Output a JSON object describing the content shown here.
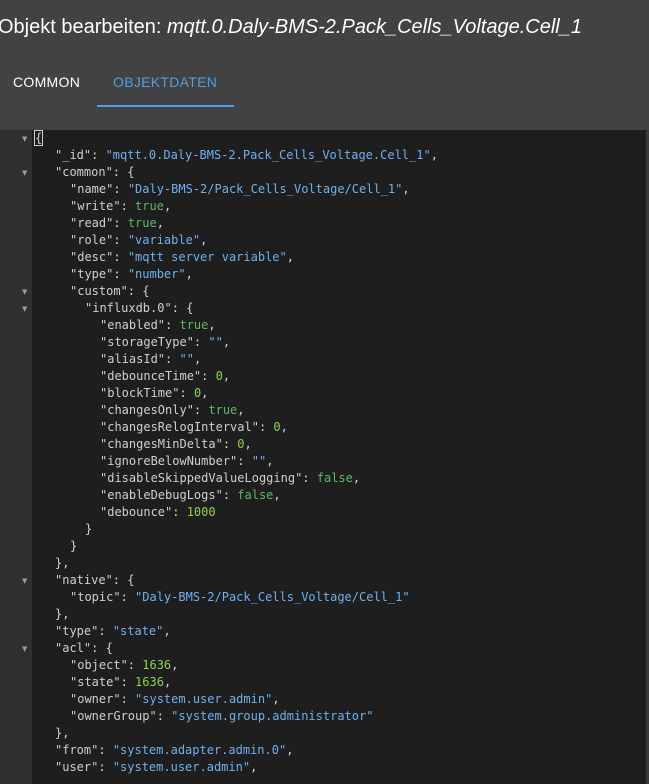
{
  "dialog": {
    "title_prefix": "Objekt bearbeiten:",
    "title_object": "mqtt.0.Daly-BMS-2.Pack_Cells_Voltage.Cell_1"
  },
  "tabs": [
    {
      "label": "COMMON",
      "active": false
    },
    {
      "label": "OBJEKTDATEN",
      "active": true
    }
  ],
  "colors": {
    "accent": "#4f9ee3",
    "string": "#6fb0ee",
    "number": "#8fd14f",
    "boolean": "#5fb86a",
    "editor_bg": "#1e1e1e",
    "header_bg": "#424242"
  },
  "fold_icon": "caret-down-icon",
  "editor": {
    "lines": [
      {
        "indent": 0,
        "fold": true,
        "parts": [
          [
            "{",
            "cb"
          ]
        ]
      },
      {
        "indent": 1,
        "fold": false,
        "parts": [
          [
            "\"_id\"",
            "k"
          ],
          [
            ": ",
            "p"
          ],
          [
            "\"mqtt.0.Daly-BMS-2.Pack_Cells_Voltage.Cell_1\"",
            "s"
          ],
          [
            ",",
            "p"
          ]
        ]
      },
      {
        "indent": 1,
        "fold": true,
        "parts": [
          [
            "\"common\"",
            "k"
          ],
          [
            ": {",
            "p"
          ]
        ]
      },
      {
        "indent": 2,
        "fold": false,
        "parts": [
          [
            "\"name\"",
            "k"
          ],
          [
            ": ",
            "p"
          ],
          [
            "\"Daly-BMS-2/Pack_Cells_Voltage/Cell_1\"",
            "s"
          ],
          [
            ",",
            "p"
          ]
        ]
      },
      {
        "indent": 2,
        "fold": false,
        "parts": [
          [
            "\"write\"",
            "k"
          ],
          [
            ": ",
            "p"
          ],
          [
            "true",
            "b"
          ],
          [
            ",",
            "p"
          ]
        ]
      },
      {
        "indent": 2,
        "fold": false,
        "parts": [
          [
            "\"read\"",
            "k"
          ],
          [
            ": ",
            "p"
          ],
          [
            "true",
            "b"
          ],
          [
            ",",
            "p"
          ]
        ]
      },
      {
        "indent": 2,
        "fold": false,
        "parts": [
          [
            "\"role\"",
            "k"
          ],
          [
            ": ",
            "p"
          ],
          [
            "\"variable\"",
            "s"
          ],
          [
            ",",
            "p"
          ]
        ]
      },
      {
        "indent": 2,
        "fold": false,
        "parts": [
          [
            "\"desc\"",
            "k"
          ],
          [
            ": ",
            "p"
          ],
          [
            "\"mqtt server variable\"",
            "s"
          ],
          [
            ",",
            "p"
          ]
        ]
      },
      {
        "indent": 2,
        "fold": false,
        "parts": [
          [
            "\"type\"",
            "k"
          ],
          [
            ": ",
            "p"
          ],
          [
            "\"number\"",
            "s"
          ],
          [
            ",",
            "p"
          ]
        ]
      },
      {
        "indent": 2,
        "fold": true,
        "parts": [
          [
            "\"custom\"",
            "k"
          ],
          [
            ": {",
            "p"
          ]
        ]
      },
      {
        "indent": 3,
        "fold": true,
        "parts": [
          [
            "\"influxdb.0\"",
            "k"
          ],
          [
            ": {",
            "p"
          ]
        ]
      },
      {
        "indent": 4,
        "fold": false,
        "parts": [
          [
            "\"enabled\"",
            "k"
          ],
          [
            ": ",
            "p"
          ],
          [
            "true",
            "b"
          ],
          [
            ",",
            "p"
          ]
        ]
      },
      {
        "indent": 4,
        "fold": false,
        "parts": [
          [
            "\"storageType\"",
            "k"
          ],
          [
            ": ",
            "p"
          ],
          [
            "\"\"",
            "s"
          ],
          [
            ",",
            "p"
          ]
        ]
      },
      {
        "indent": 4,
        "fold": false,
        "parts": [
          [
            "\"aliasId\"",
            "k"
          ],
          [
            ": ",
            "p"
          ],
          [
            "\"\"",
            "s"
          ],
          [
            ",",
            "p"
          ]
        ]
      },
      {
        "indent": 4,
        "fold": false,
        "parts": [
          [
            "\"debounceTime\"",
            "k"
          ],
          [
            ": ",
            "p"
          ],
          [
            "0",
            "n"
          ],
          [
            ",",
            "p"
          ]
        ]
      },
      {
        "indent": 4,
        "fold": false,
        "parts": [
          [
            "\"blockTime\"",
            "k"
          ],
          [
            ": ",
            "p"
          ],
          [
            "0",
            "n"
          ],
          [
            ",",
            "p"
          ]
        ]
      },
      {
        "indent": 4,
        "fold": false,
        "parts": [
          [
            "\"changesOnly\"",
            "k"
          ],
          [
            ": ",
            "p"
          ],
          [
            "true",
            "b"
          ],
          [
            ",",
            "p"
          ]
        ]
      },
      {
        "indent": 4,
        "fold": false,
        "parts": [
          [
            "\"changesRelogInterval\"",
            "k"
          ],
          [
            ": ",
            "p"
          ],
          [
            "0",
            "n"
          ],
          [
            ",",
            "p"
          ]
        ]
      },
      {
        "indent": 4,
        "fold": false,
        "parts": [
          [
            "\"changesMinDelta\"",
            "k"
          ],
          [
            ": ",
            "p"
          ],
          [
            "0",
            "n"
          ],
          [
            ",",
            "p"
          ]
        ]
      },
      {
        "indent": 4,
        "fold": false,
        "parts": [
          [
            "\"ignoreBelowNumber\"",
            "k"
          ],
          [
            ": ",
            "p"
          ],
          [
            "\"\"",
            "s"
          ],
          [
            ",",
            "p"
          ]
        ]
      },
      {
        "indent": 4,
        "fold": false,
        "parts": [
          [
            "\"disableSkippedValueLogging\"",
            "k"
          ],
          [
            ": ",
            "p"
          ],
          [
            "false",
            "b"
          ],
          [
            ",",
            "p"
          ]
        ]
      },
      {
        "indent": 4,
        "fold": false,
        "parts": [
          [
            "\"enableDebugLogs\"",
            "k"
          ],
          [
            ": ",
            "p"
          ],
          [
            "false",
            "b"
          ],
          [
            ",",
            "p"
          ]
        ]
      },
      {
        "indent": 4,
        "fold": false,
        "parts": [
          [
            "\"debounce\"",
            "k"
          ],
          [
            ": ",
            "p"
          ],
          [
            "1000",
            "n"
          ]
        ]
      },
      {
        "indent": 3,
        "fold": false,
        "parts": [
          [
            "}",
            "p"
          ]
        ]
      },
      {
        "indent": 2,
        "fold": false,
        "parts": [
          [
            "}",
            "p"
          ]
        ]
      },
      {
        "indent": 1,
        "fold": false,
        "parts": [
          [
            "},",
            "p"
          ]
        ]
      },
      {
        "indent": 1,
        "fold": true,
        "parts": [
          [
            "\"native\"",
            "k"
          ],
          [
            ": {",
            "p"
          ]
        ]
      },
      {
        "indent": 2,
        "fold": false,
        "parts": [
          [
            "\"topic\"",
            "k"
          ],
          [
            ": ",
            "p"
          ],
          [
            "\"Daly-BMS-2/Pack_Cells_Voltage/Cell_1\"",
            "s"
          ]
        ]
      },
      {
        "indent": 1,
        "fold": false,
        "parts": [
          [
            "},",
            "p"
          ]
        ]
      },
      {
        "indent": 1,
        "fold": false,
        "parts": [
          [
            "\"type\"",
            "k"
          ],
          [
            ": ",
            "p"
          ],
          [
            "\"state\"",
            "s"
          ],
          [
            ",",
            "p"
          ]
        ]
      },
      {
        "indent": 1,
        "fold": true,
        "parts": [
          [
            "\"acl\"",
            "k"
          ],
          [
            ": {",
            "p"
          ]
        ]
      },
      {
        "indent": 2,
        "fold": false,
        "parts": [
          [
            "\"object\"",
            "k"
          ],
          [
            ": ",
            "p"
          ],
          [
            "1636",
            "n"
          ],
          [
            ",",
            "p"
          ]
        ]
      },
      {
        "indent": 2,
        "fold": false,
        "parts": [
          [
            "\"state\"",
            "k"
          ],
          [
            ": ",
            "p"
          ],
          [
            "1636",
            "n"
          ],
          [
            ",",
            "p"
          ]
        ]
      },
      {
        "indent": 2,
        "fold": false,
        "parts": [
          [
            "\"owner\"",
            "k"
          ],
          [
            ": ",
            "p"
          ],
          [
            "\"system.user.admin\"",
            "s"
          ],
          [
            ",",
            "p"
          ]
        ]
      },
      {
        "indent": 2,
        "fold": false,
        "parts": [
          [
            "\"ownerGroup\"",
            "k"
          ],
          [
            ": ",
            "p"
          ],
          [
            "\"system.group.administrator\"",
            "s"
          ]
        ]
      },
      {
        "indent": 1,
        "fold": false,
        "parts": [
          [
            "},",
            "p"
          ]
        ]
      },
      {
        "indent": 1,
        "fold": false,
        "parts": [
          [
            "\"from\"",
            "k"
          ],
          [
            ": ",
            "p"
          ],
          [
            "\"system.adapter.admin.0\"",
            "s"
          ],
          [
            ",",
            "p"
          ]
        ]
      },
      {
        "indent": 1,
        "fold": false,
        "parts": [
          [
            "\"user\"",
            "k"
          ],
          [
            ": ",
            "p"
          ],
          [
            "\"system.user.admin\"",
            "s"
          ],
          [
            ",",
            "p"
          ]
        ]
      }
    ]
  }
}
